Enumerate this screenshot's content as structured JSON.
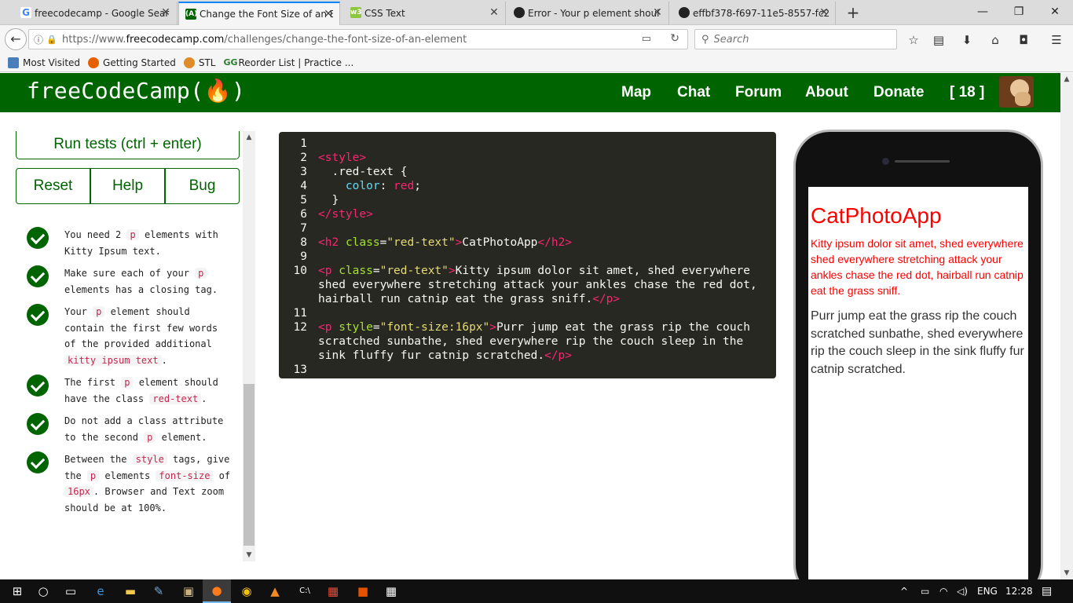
{
  "browser": {
    "tabs": [
      {
        "title": "freecodecamp - Google Sear",
        "favicon": "G"
      },
      {
        "title": "Change the Font Size of an E",
        "favicon": "(A)"
      },
      {
        "title": "CSS Text",
        "favicon": "w3"
      },
      {
        "title": "Error - Your p element shoul",
        "favicon": "github"
      },
      {
        "title": "effbf378-f697-11e5-8557-fc2",
        "favicon": "github"
      }
    ],
    "url_prefix": "https://www.",
    "url_domain": "freecodecamp.com",
    "url_path": "/challenges/change-the-font-size-of-an-element",
    "search_placeholder": "Search",
    "bookmarks": [
      "Most Visited",
      "Getting Started",
      "STL",
      "Reorder List | Practice ..."
    ]
  },
  "header": {
    "logo": "freeCodeCamp(🔥)",
    "nav": [
      "Map",
      "Chat",
      "Forum",
      "About",
      "Donate"
    ],
    "points": "[ 18 ]",
    "brand_color": "#006400"
  },
  "left": {
    "run_label": "Run tests (ctrl + enter)",
    "reset_label": "Reset",
    "help_label": "Help",
    "bug_label": "Bug"
  },
  "editor": {
    "lines": [
      "1",
      "2",
      "3",
      "4",
      "5",
      "6",
      "7",
      "8",
      "9",
      "10",
      "",
      "",
      "11",
      "12",
      "",
      "",
      "13"
    ]
  },
  "preview": {
    "heading": "CatPhotoApp",
    "p1": "Kitty ipsum dolor sit amet, shed everywhere shed everywhere stretching attack your ankles chase the red dot, hairball run catnip eat the grass sniff.",
    "p2": "Purr jump eat the grass rip the couch scratched sunbathe, shed everywhere rip the couch sleep in the sink fluffy fur catnip scratched."
  },
  "taskbar": {
    "language": "ENG",
    "time": "12:28"
  }
}
